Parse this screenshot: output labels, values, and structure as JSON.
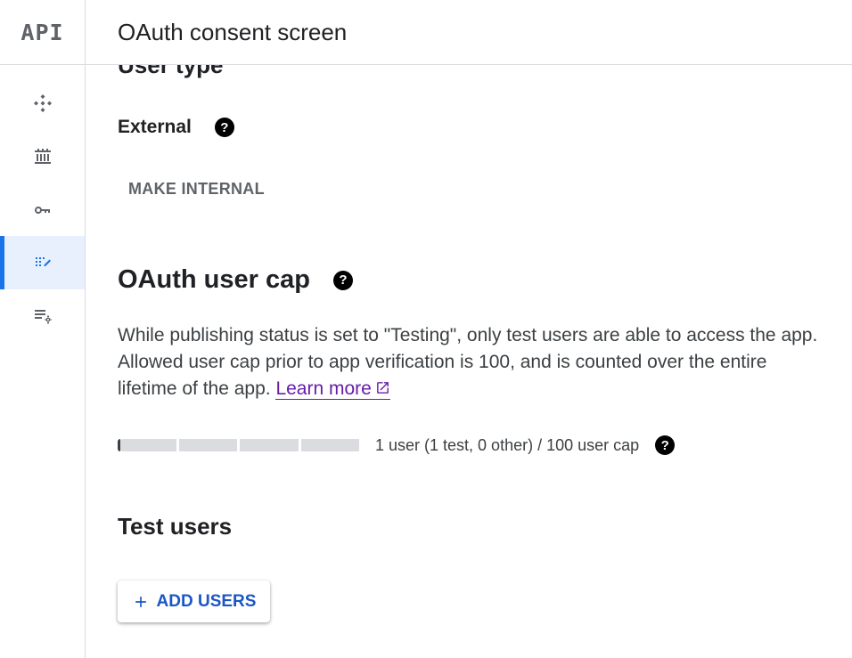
{
  "app": {
    "logo": "API"
  },
  "header": {
    "title": "OAuth consent screen"
  },
  "sidebar": {
    "items": [
      {
        "icon": "dashboard-icon",
        "active": false
      },
      {
        "icon": "library-icon",
        "active": false
      },
      {
        "icon": "key-icon",
        "active": false
      },
      {
        "icon": "consent-icon",
        "active": true
      },
      {
        "icon": "settings-list-icon",
        "active": false
      }
    ]
  },
  "main": {
    "user_type_title": "User type",
    "user_type_value": "External",
    "make_internal_label": "MAKE INTERNAL",
    "cap_title": "OAuth user cap",
    "cap_description": "While publishing status is set to \"Testing\", only test users are able to access the app. Allowed user cap prior to app verification is 100, and is counted over the entire lifetime of the app. ",
    "learn_more_label": "Learn more",
    "progress": {
      "users": 1,
      "cap": 100,
      "fraction": 0.01
    },
    "progress_text": "1 user (1 test, 0 other) / 100 user cap",
    "test_users_title": "Test users",
    "add_users_label": "ADD USERS"
  },
  "colors": {
    "accent": "#1a73e8",
    "link_visited": "#681da8",
    "button_text": "#1a56c6",
    "active_bg": "#e8f0fe"
  }
}
